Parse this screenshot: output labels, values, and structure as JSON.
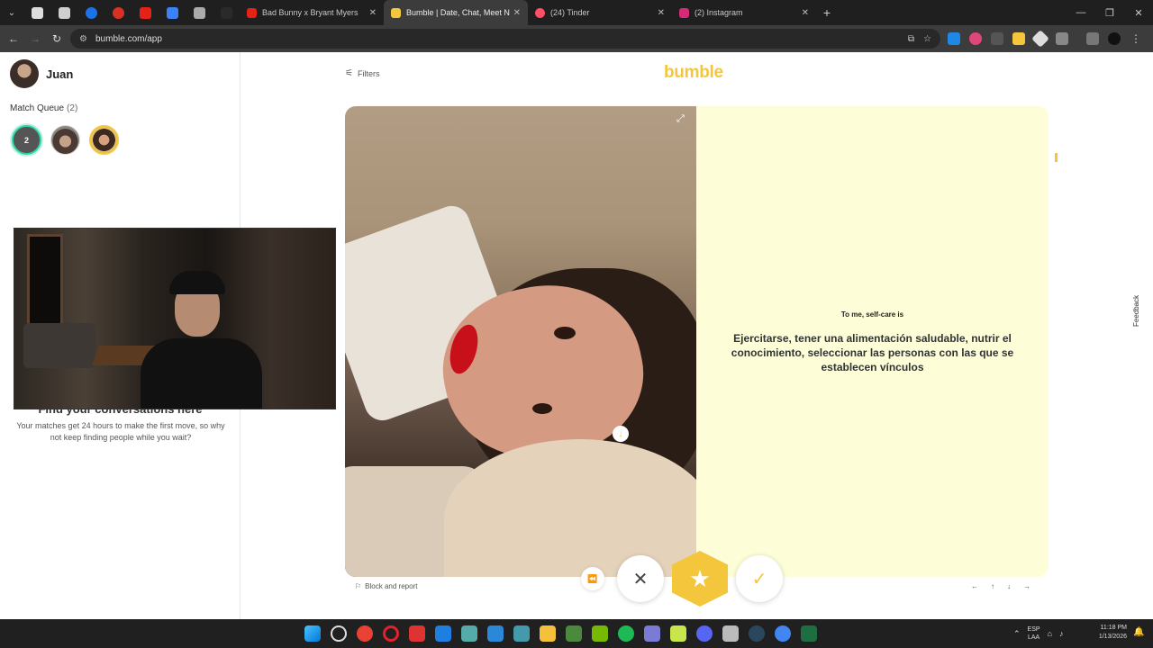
{
  "browser": {
    "tabs": [
      {
        "title": "Bad Bunny x Bryant Myers",
        "favicon_color": "#e62117",
        "close": "✕",
        "active": false
      },
      {
        "title": "Bumble | Date, Chat, Meet New",
        "favicon_color": "#f4c63c",
        "close": "✕",
        "active": true
      },
      {
        "title": "(24) Tinder",
        "favicon_color": "#fd5068",
        "close": "✕",
        "active": false
      },
      {
        "title": "(2) Instagram",
        "favicon_color": "#d62976",
        "close": "✕",
        "active": false
      }
    ],
    "new_tab": "+",
    "url": "bumble.com/app"
  },
  "sidebar": {
    "user_name": "Juan",
    "match_queue_label": "Match Queue",
    "match_queue_count": "(2)",
    "queue_badge": "2",
    "conversations_title": "Find your conversations here",
    "conversations_sub": "Your matches get 24 hours to make the first move, so why not keep finding people while you wait?"
  },
  "main": {
    "filters_label": "Filters",
    "logo": "bumble",
    "prompt": "To me, self-care is",
    "answer": "Ejercitarse, tener una alimentación saludable, nutrir el conocimiento, seleccionar las personas con las que se establecen vínculos",
    "block_label": "Block and report",
    "feedback_label": "Feedback",
    "keyboard_hints": [
      "←",
      "↑",
      "↓",
      "→"
    ]
  },
  "actions": {
    "rewind_icon": "rewind-icon",
    "pass_icon": "close-icon",
    "superswipe_icon": "star-icon",
    "like_icon": "check-icon"
  },
  "colors": {
    "brand": "#f4c63c",
    "card_bg": "#fdfed8",
    "queue_ring": "#2fd4a8"
  },
  "taskbar": {
    "language": "ESP\nLAA",
    "time": "11:18 PM",
    "date": "1/13/2026"
  }
}
